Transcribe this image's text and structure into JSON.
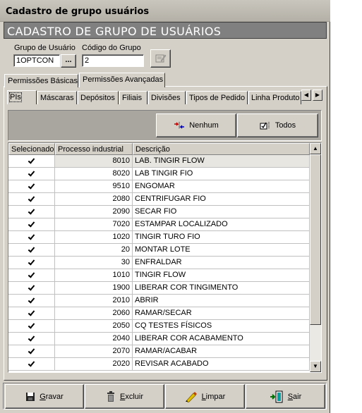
{
  "window": {
    "title": "Cadastro de grupo usuários"
  },
  "header": {
    "banner": "CADASTRO DE GRUPO DE USUÁRIOS"
  },
  "form": {
    "group_label": "Grupo de Usuário",
    "group_value": "1OPTCON",
    "lookup_label": "...",
    "code_label": "Código do Grupo",
    "code_value": "2"
  },
  "tabs": [
    {
      "label": "Permissões Básicas"
    },
    {
      "label": "Permissões Avançadas"
    }
  ],
  "subtabs": [
    {
      "label": "PIs"
    },
    {
      "label": "Máscaras"
    },
    {
      "label": "Depósitos"
    },
    {
      "label": "Filiais"
    },
    {
      "label": "Divisões"
    },
    {
      "label": "Tipos de Pedido"
    },
    {
      "label": "Linha Produto"
    }
  ],
  "actions": {
    "none_label": "Nenhum",
    "all_label": "Todos"
  },
  "grid": {
    "columns": [
      "Selecionado",
      "Processo industrial",
      "Descrição"
    ],
    "rows": [
      {
        "selected": true,
        "process": "8010",
        "desc": "LAB. TINGIR FLOW"
      },
      {
        "selected": true,
        "process": "8020",
        "desc": "LAB TINGIR FIO"
      },
      {
        "selected": true,
        "process": "9510",
        "desc": "ENGOMAR"
      },
      {
        "selected": true,
        "process": "2080",
        "desc": "CENTRIFUGAR FIO"
      },
      {
        "selected": true,
        "process": "2090",
        "desc": "SECAR FIO"
      },
      {
        "selected": true,
        "process": "7020",
        "desc": "ESTAMPAR LOCALIZADO"
      },
      {
        "selected": true,
        "process": "1020",
        "desc": "TINGIR TURO FIO"
      },
      {
        "selected": true,
        "process": "20",
        "desc": "MONTAR LOTE"
      },
      {
        "selected": true,
        "process": "30",
        "desc": "ENFRALDAR"
      },
      {
        "selected": true,
        "process": "1010",
        "desc": "TINGIR FLOW"
      },
      {
        "selected": true,
        "process": "1900",
        "desc": "LIBERAR COR TINGIMENTO"
      },
      {
        "selected": true,
        "process": "2010",
        "desc": "ABRIR"
      },
      {
        "selected": true,
        "process": "2060",
        "desc": "RAMAR/SECAR"
      },
      {
        "selected": true,
        "process": "2050",
        "desc": "CQ TESTES FÍSICOS"
      },
      {
        "selected": true,
        "process": "2040",
        "desc": "LIBERAR COR ACABAMENTO"
      },
      {
        "selected": true,
        "process": "2070",
        "desc": "RAMAR/ACABAR"
      },
      {
        "selected": true,
        "process": "2020",
        "desc": "REVISAR ACABADO"
      }
    ]
  },
  "footer": {
    "save_label": "Gravar",
    "delete_label": "Excluir",
    "clear_label": "Limpar",
    "exit_label": "Sair"
  }
}
